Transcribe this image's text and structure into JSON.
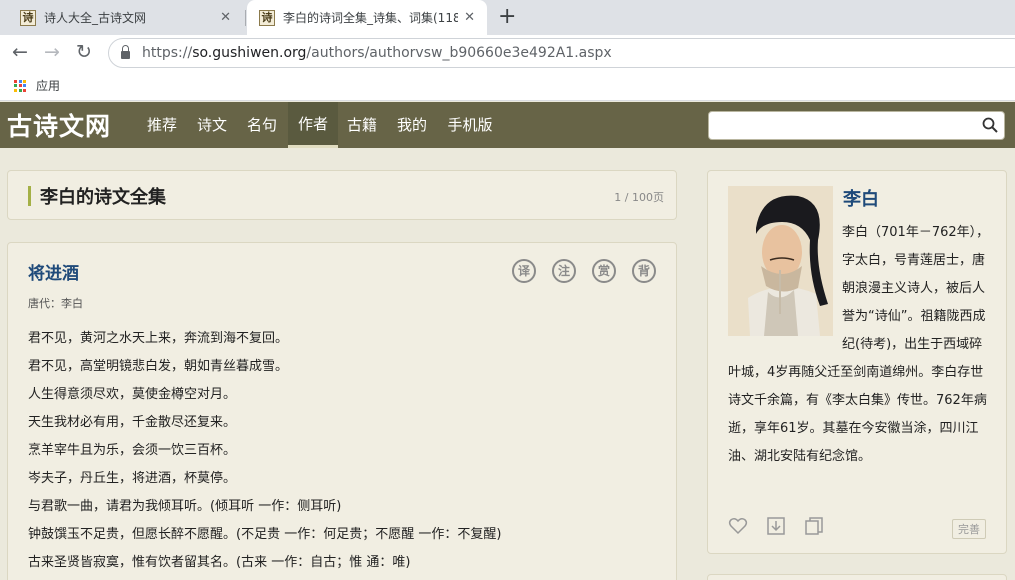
{
  "browser": {
    "tabs": [
      {
        "title": "诗人大全_古诗文网",
        "active": false
      },
      {
        "title": "李白的诗词全集_诗集、词集(118",
        "active": true
      }
    ],
    "favicon_glyph": "诗",
    "url_scheme": "https://",
    "url_host": "so.gushiwen.org",
    "url_path": "/authors/authorvsw_b90660e3e492A1.aspx",
    "bookmark_apps": "应用",
    "new_tab_glyph": "+",
    "close_glyph": "✕"
  },
  "site": {
    "logo": "古诗文网",
    "nav": [
      {
        "label": "推荐",
        "active": false
      },
      {
        "label": "诗文",
        "active": false
      },
      {
        "label": "名句",
        "active": false
      },
      {
        "label": "作者",
        "active": true
      },
      {
        "label": "古籍",
        "active": false
      },
      {
        "label": "我的",
        "active": false
      },
      {
        "label": "手机版",
        "active": false
      }
    ],
    "search_value": ""
  },
  "page": {
    "heading": "李白的诗文全集",
    "pagination": "1 / 100页"
  },
  "poem": {
    "title": "将进酒",
    "author": "唐代：李白",
    "tools": [
      "译",
      "注",
      "赏",
      "背"
    ],
    "lines": [
      "君不见，黄河之水天上来，奔流到海不复回。",
      "君不见，高堂明镜悲白发，朝如青丝暮成雪。",
      "人生得意须尽欢，莫使金樽空对月。",
      "天生我材必有用，千金散尽还复来。",
      "烹羊宰牛且为乐，会须一饮三百杯。",
      "岑夫子，丹丘生，将进酒，杯莫停。",
      "与君歌一曲，请君为我倾耳听。(倾耳听 一作：侧耳听)",
      "钟鼓馔玉不足贵，但愿长醉不愿醒。(不足贵 一作：何足贵；不愿醒 一作：不复醒)",
      "古来圣贤皆寂寞，惟有饮者留其名。(古来 一作：自古；惟 通：唯)"
    ]
  },
  "author": {
    "name": "李白",
    "bio": "李白（701年－762年），字太白，号青莲居士，唐朝浪漫主义诗人，被后人誉为“诗仙”。祖籍陇西成纪(待考)，出生于西域碎叶城，4岁再随父迁至剑南道绵州。李白存世诗文千余篇，有《李太白集》传世。762年病逝，享年61岁。其墓在今安徽当涂，四川江油、湖北安陆有纪念馆。",
    "perfect_label": "完善",
    "action_icons": [
      "heart-icon",
      "download-icon",
      "copy-icon"
    ]
  },
  "colors": {
    "header_bg": "#676447",
    "accent_bar": "#a4b046",
    "title_blue": "#1f4a7a",
    "page_bg": "#ebe9dc"
  }
}
